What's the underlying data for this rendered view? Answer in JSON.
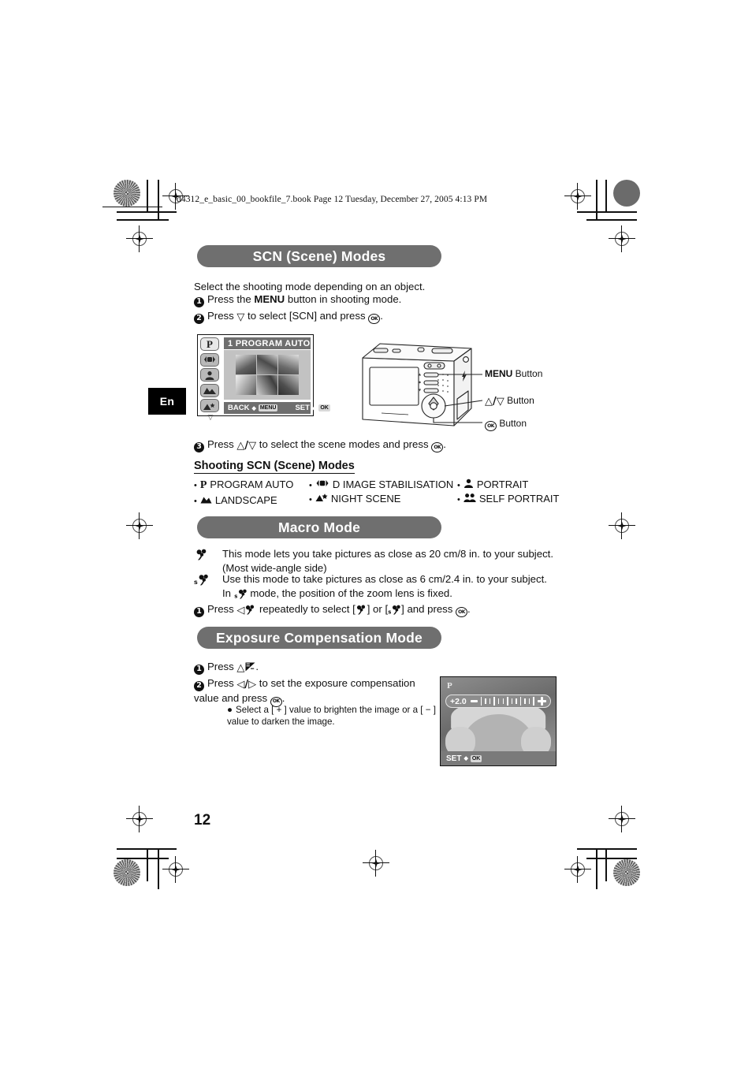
{
  "print_header": {
    "bookfile": "d4312_e_basic_00_bookfile_7.book  Page 12  Tuesday, December 27, 2005  4:13 PM"
  },
  "language_tab": {
    "label": "En"
  },
  "page_number": "12",
  "sections": {
    "scn": {
      "title": "SCN (Scene) Modes",
      "intro": "Select the shooting mode depending on an object.",
      "steps": [
        {
          "num": "1",
          "pre": "Press the ",
          "bold": "MENU",
          "post": " button in shooting mode."
        },
        {
          "num": "2",
          "pre": "Press ",
          "glyph": "▽",
          "post": " to select [SCN] and press ",
          "ok": "OK",
          "end": "."
        },
        {
          "num": "3",
          "pre": "Press ",
          "glyph": "△/▽",
          "post": " to select the scene modes and press ",
          "ok": "OK",
          "end": "."
        }
      ],
      "lcd": {
        "title": "1 PROGRAM AUTO",
        "sidebar_icons": [
          "P",
          "image-stabilisation",
          "portrait",
          "landscape",
          "night-scene"
        ],
        "selected_sidebar": "P",
        "footer_back": "BACK",
        "footer_back_key": "MENU",
        "footer_set": "SET",
        "footer_set_key": "OK",
        "thumbnail_count": 6
      },
      "camera_callouts": [
        {
          "bold": "MENU",
          "rest": " Button"
        },
        {
          "bold": "△/▽",
          "rest": " Button"
        },
        {
          "bold": "OK",
          "rest": " Button"
        }
      ],
      "subhead": "Shooting SCN (Scene) Modes",
      "modes": [
        {
          "icon": "P",
          "label": "PROGRAM AUTO"
        },
        {
          "icon": "landscape",
          "label": "LANDSCAPE"
        },
        {
          "icon": "image-stabilisation",
          "label": "D IMAGE STABILISATION"
        },
        {
          "icon": "night-scene",
          "label": "NIGHT SCENE"
        },
        {
          "icon": "portrait",
          "label": "PORTRAIT"
        },
        {
          "icon": "self-portrait",
          "label": "SELF PORTRAIT"
        }
      ]
    },
    "macro": {
      "title": "Macro Mode",
      "rows": [
        {
          "icon": "macro-flower",
          "text": "This mode lets you take pictures as close as 20 cm/8 in. to your subject. (Most wide-angle side)"
        },
        {
          "icon": "super-macro-flower",
          "text_a": "Use this mode to take pictures as close as 6 cm/2.4 in. to your subject. In ",
          "text_b": " mode, the position of the zoom lens is fixed."
        }
      ],
      "step": {
        "num": "1",
        "pre": "Press ",
        "glyph": "◁",
        "mid": " repeatedly to select [",
        "opt_a": "macro",
        "mid2": "] or [",
        "opt_b": "super-macro",
        "mid3": "] and press ",
        "ok": "OK",
        "end": "."
      }
    },
    "exposure": {
      "title": "Exposure Compensation Mode",
      "steps": [
        {
          "num": "1",
          "pre": "Press ",
          "glyph": "△",
          "icon": "exposure-comp",
          "end": "."
        },
        {
          "num": "2",
          "pre": "Press ",
          "glyph": "◁/▷",
          "post": " to set the exposure compensation value and press ",
          "ok": "OK",
          "end": "."
        }
      ],
      "bullet": "Select a [ + ] value to brighten the image or a [ − ] value to darken the image.",
      "lcd": {
        "mode_indicator": "P",
        "value": "+2.0",
        "minus_label": "−",
        "plus_label": "+",
        "footer_set": "SET",
        "footer_set_key": "OK"
      }
    }
  },
  "colors": {
    "title_bar_gray": "#6f6f6f",
    "lcd_header_gray": "#6e6e6e",
    "text_black": "#111111",
    "tab_black": "#000000"
  }
}
